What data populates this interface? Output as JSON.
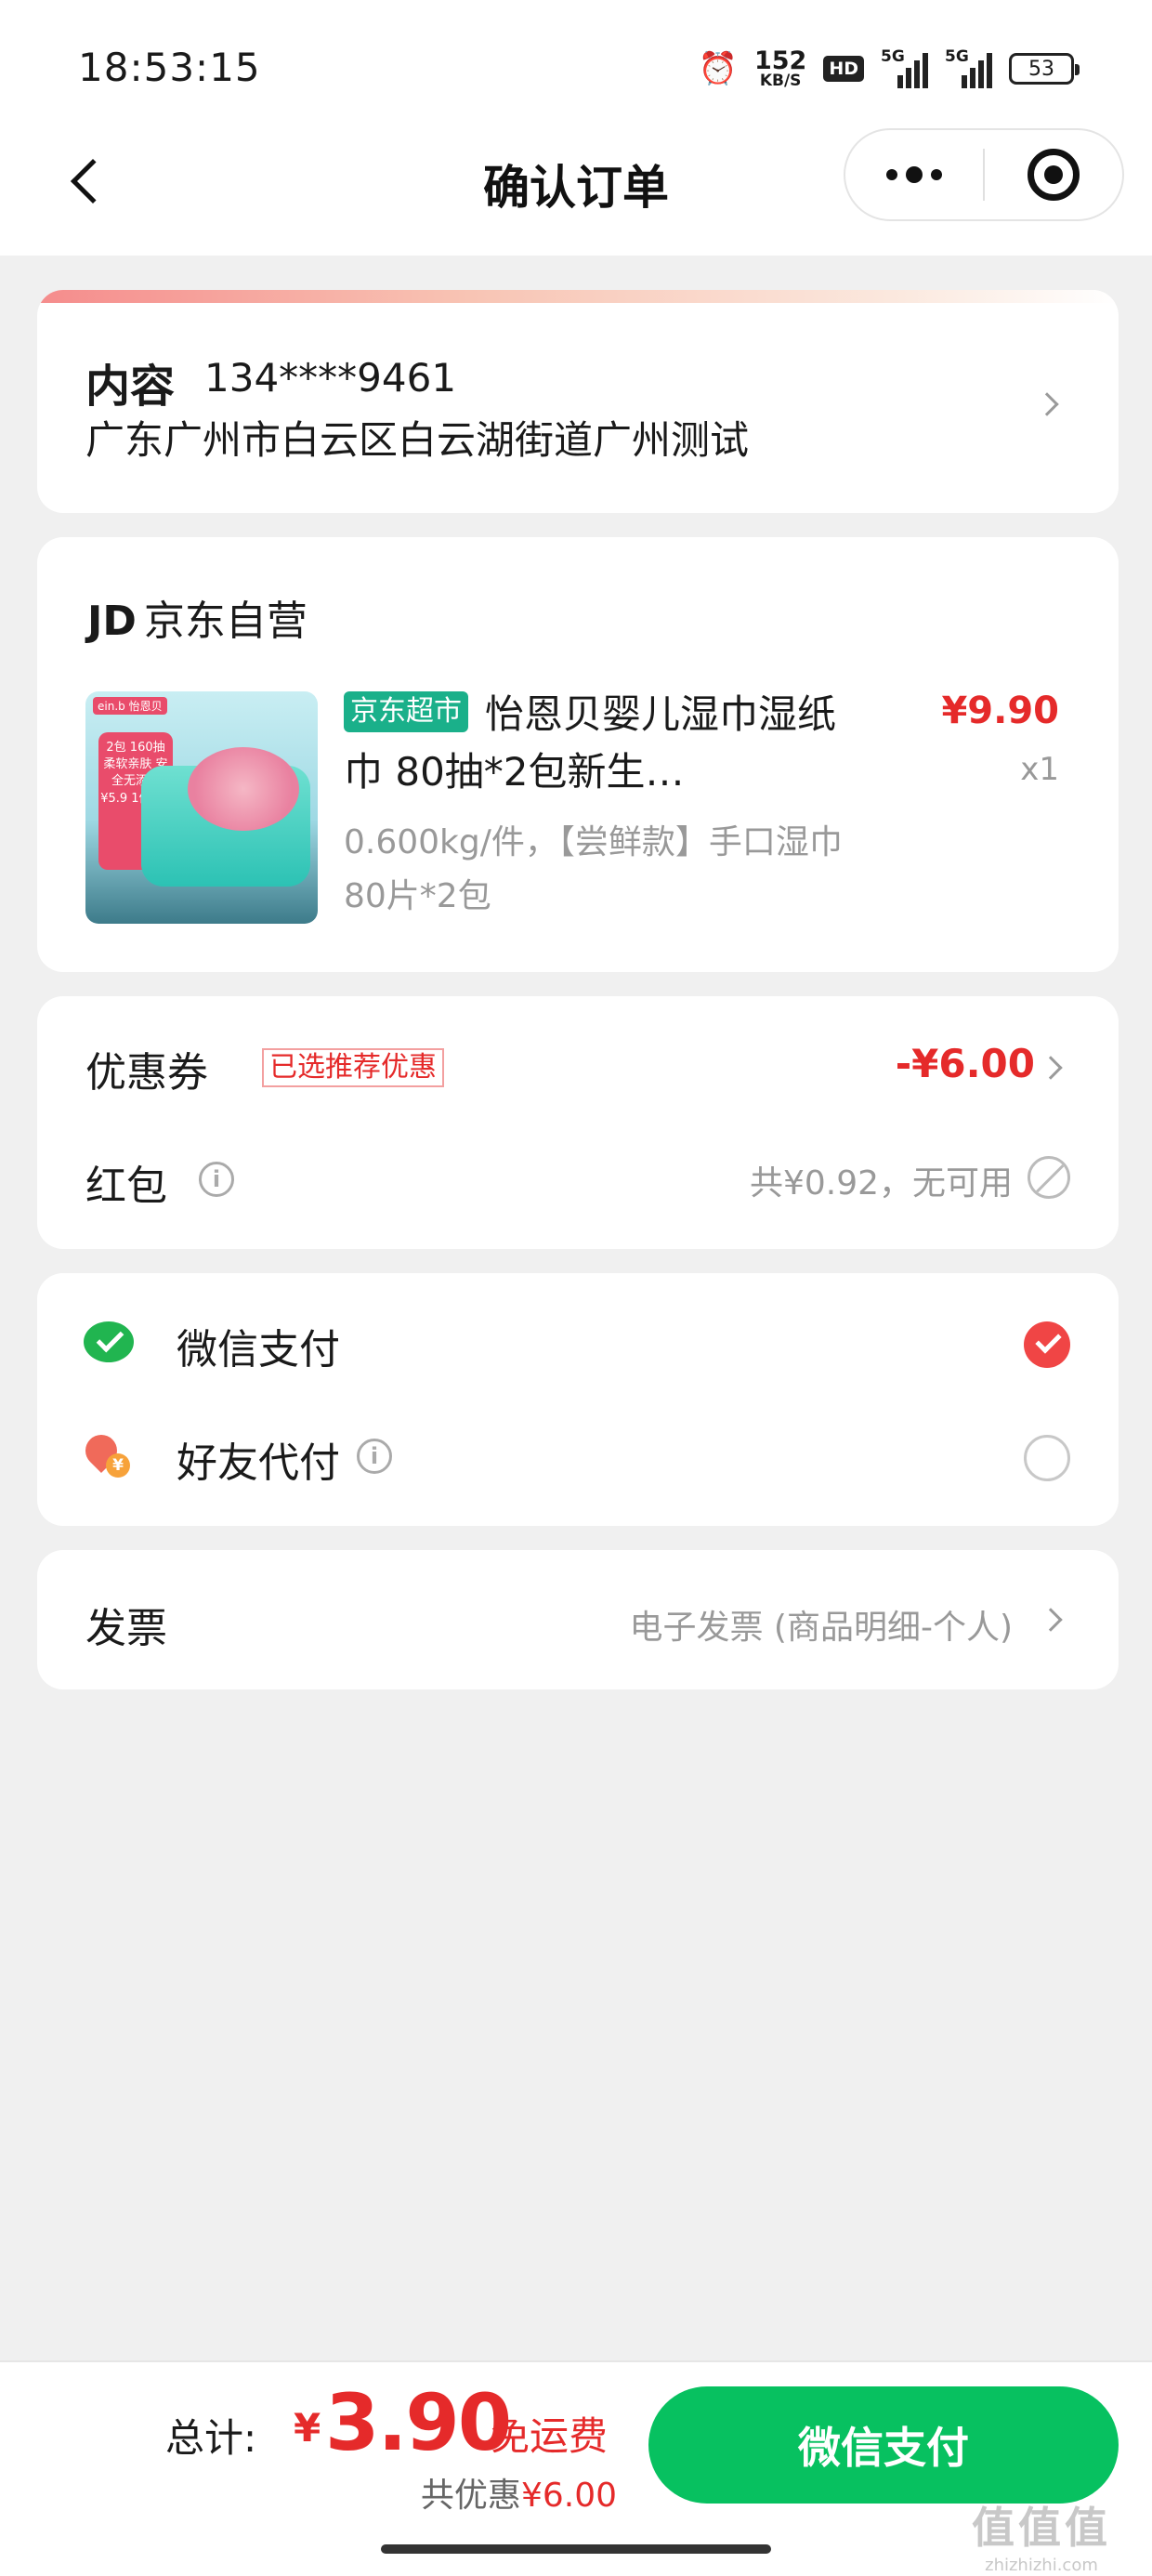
{
  "status_bar": {
    "time": "18:53:15",
    "speed_value": "152",
    "speed_unit": "KB/S",
    "hd": "HD",
    "signal1": "5G",
    "signal2": "5G",
    "battery": "53"
  },
  "nav": {
    "title": "确认订单"
  },
  "address": {
    "name": "内容",
    "phone": "134****9461",
    "line": "广东广州市白云区白云湖街道广州测试"
  },
  "shop": {
    "prefix": "JD",
    "name": "京东自营"
  },
  "product": {
    "badge": "京东超市",
    "title": "怡恩贝婴儿湿巾湿纸巾 80抽*2包新生…",
    "spec": "0.600kg/件，【尝鲜款】手口湿巾80片*2包",
    "price": "¥9.90",
    "qty": "x1",
    "image_brand": "ein.b 怡恩贝",
    "image_tag": "2包 160抽 柔软亲肤 安全无添加 ¥5.9 1件6折"
  },
  "discounts": {
    "coupon_label": "优惠券",
    "coupon_tag": "已选推荐优惠",
    "coupon_value": "-¥6.00",
    "redpack_label": "红包",
    "redpack_value": "共¥0.92，无可用"
  },
  "payment": {
    "wechat_label": "微信支付",
    "friend_label": "好友代付"
  },
  "invoice": {
    "label": "发票",
    "value": "电子发票 (商品明细-个人)"
  },
  "bottom": {
    "total_label": "总计:",
    "currency": "¥",
    "total_amount": "3.90",
    "free_shipping": "免运费",
    "saved_prefix": "共优惠",
    "saved_amount": "¥6.00",
    "pay_button": "微信支付"
  },
  "watermark": {
    "big": "值值值",
    "small": "zhizhizhi.com"
  },
  "colors": {
    "price_red": "#e52a2a",
    "wechat_green": "#07c160",
    "jd_badge_green": "#1ab08a"
  }
}
